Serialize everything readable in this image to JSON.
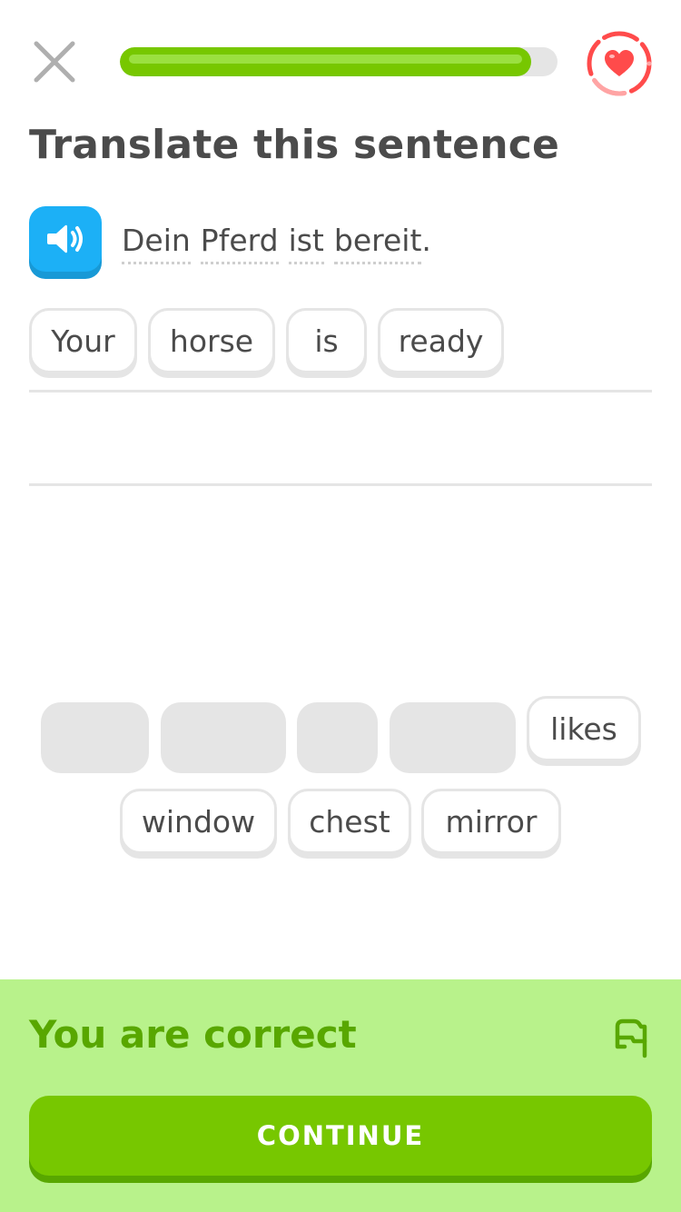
{
  "header": {
    "close_icon": "close-icon",
    "heart_icon": "heart-icon",
    "progress_fraction": 0.94,
    "colors": {
      "progress": "#77c700",
      "heart": "#ff4b4b"
    }
  },
  "exercise": {
    "title": "Translate this sentence",
    "speaker_icon": "speaker-icon",
    "prompt_words": [
      "Dein",
      "Pferd",
      "ist",
      "bereit"
    ],
    "prompt_punctuation": "."
  },
  "answer_tiles": [
    "Your",
    "horse",
    "is",
    "ready"
  ],
  "word_bank": {
    "remaining": [
      "likes",
      "window",
      "chest",
      "mirror"
    ]
  },
  "feedback": {
    "title": "You are correct",
    "report_icon": "flag-icon",
    "continue_label": "CONTINUE",
    "colors": {
      "background": "#b8f28b",
      "title": "#58a700",
      "button": "#77c700"
    }
  }
}
